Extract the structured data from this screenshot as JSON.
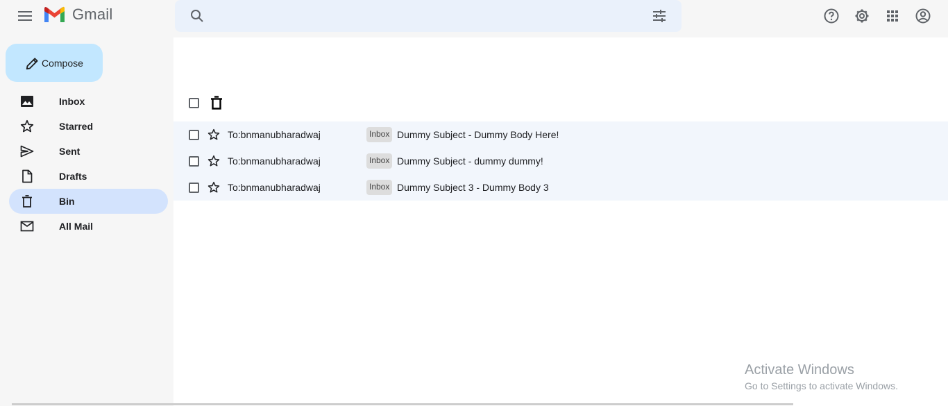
{
  "header": {
    "app_name": "Gmail",
    "search_placeholder": ""
  },
  "sidebar": {
    "compose_label": "Compose",
    "items": [
      {
        "label": "Inbox",
        "icon": "image-icon",
        "active": false
      },
      {
        "label": "Starred",
        "icon": "star-icon",
        "active": false
      },
      {
        "label": "Sent",
        "icon": "send-icon",
        "active": false
      },
      {
        "label": "Drafts",
        "icon": "draft-icon",
        "active": false
      },
      {
        "label": "Bin",
        "icon": "trash-icon",
        "active": true
      },
      {
        "label": "All Mail",
        "icon": "mail-icon",
        "active": false
      }
    ]
  },
  "emails": [
    {
      "to": "To:bnmanubharadwaj",
      "label": "Inbox",
      "subject": "Dummy Subject - Dummy Body Here!"
    },
    {
      "to": "To:bnmanubharadwaj",
      "label": "Inbox",
      "subject": "Dummy Subject - dummy dummy!"
    },
    {
      "to": "To:bnmanubharadwaj",
      "label": "Inbox",
      "subject": "Dummy Subject 3 - Dummy Body 3"
    }
  ],
  "watermark": {
    "title": "Activate Windows",
    "subtitle": "Go to Settings to activate Windows."
  },
  "colors": {
    "accent": "#c2e7ff",
    "active_nav": "#d3e3fd",
    "search_bg": "#eaf1fb",
    "row_bg": "#f2f6fc"
  }
}
